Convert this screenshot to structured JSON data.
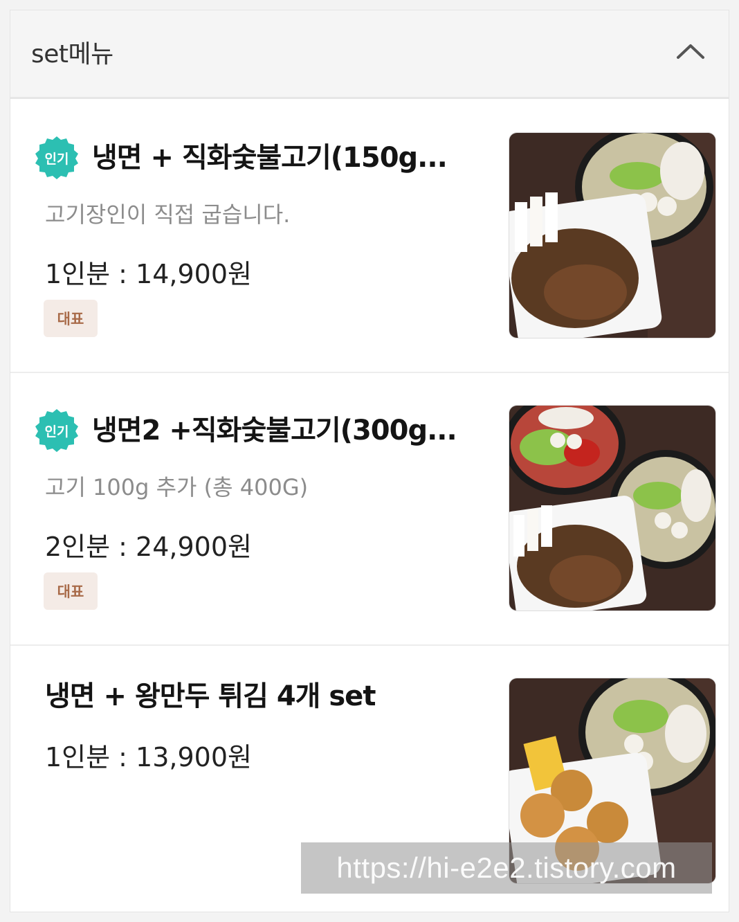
{
  "section": {
    "title": "set메뉴",
    "toggle_icon": "chevron-up-icon"
  },
  "items": [
    {
      "badge": "인기",
      "name": "냉면 + 직화숯불고기(150g...",
      "description": "고기장인이 직접 굽습니다.",
      "price": "1인분 : 14,900원",
      "tag": "대표",
      "image": "냉면과 직화숯불고기 도시락"
    },
    {
      "badge": "인기",
      "name": "냉면2 +직화숯불고기(300g...",
      "description": "고기 100g 추가 (총 400G)",
      "price": "2인분 : 24,900원",
      "tag": "대표",
      "image": "냉면 두 그릇과 직화숯불고기"
    },
    {
      "badge": "",
      "name": "냉면 + 왕만두 튀김 4개 set",
      "description": "",
      "price": "1인분 : 13,900원",
      "tag": "",
      "image": "냉면과 왕만두 튀김"
    }
  ],
  "watermark": "https://hi-e2e2.tistory.com",
  "colors": {
    "badge_teal": "#2cbfb2",
    "tag_bg": "#f4ebe6",
    "tag_text": "#a86a48",
    "header_bg": "#f5f5f5"
  }
}
